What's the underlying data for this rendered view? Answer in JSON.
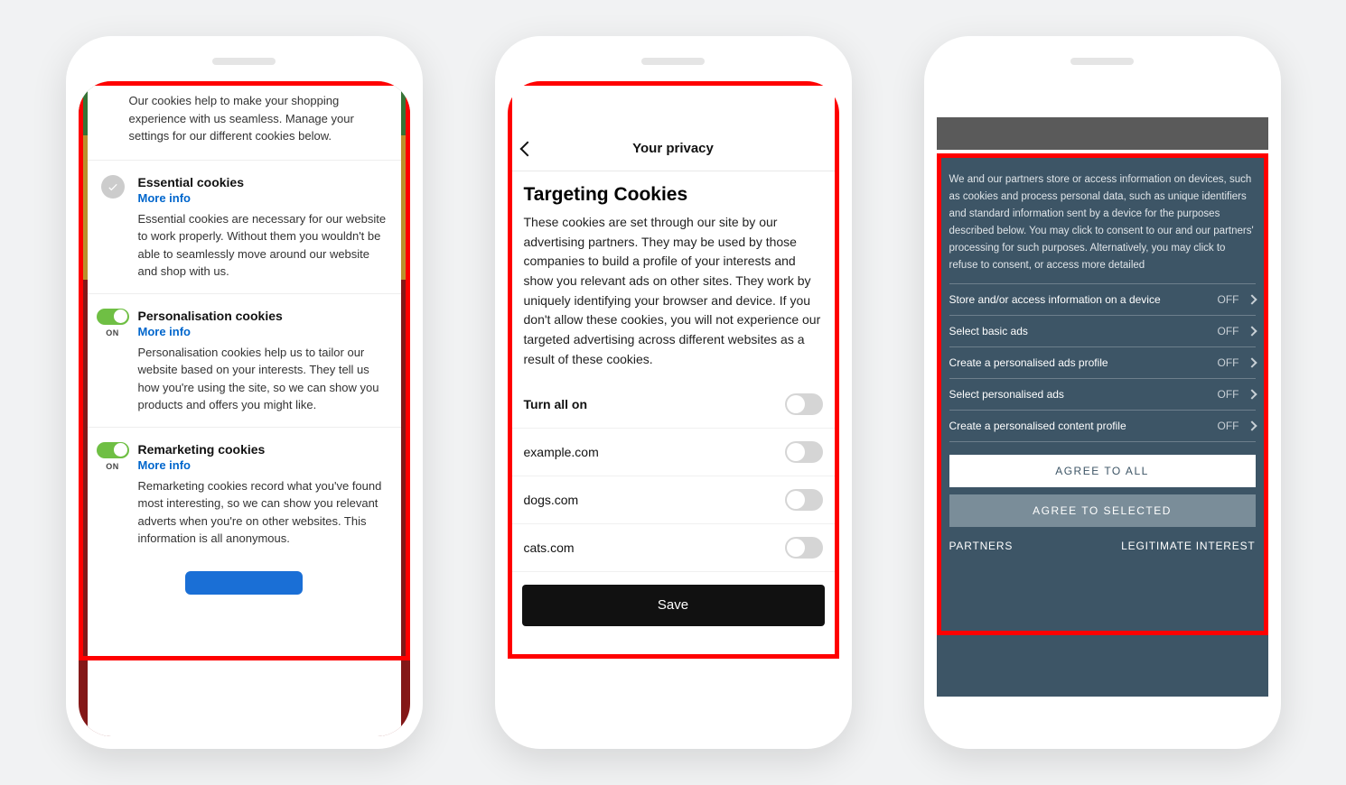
{
  "phone1": {
    "intro": "Our cookies help to make your shopping experience with us seamless. Manage your settings for our different cookies below.",
    "onLabel": "ON",
    "sections": [
      {
        "title": "Essential cookies",
        "more": "More info",
        "desc": "Essential cookies are necessary for our website to work properly. Without them you wouldn't be able to seamlessly move around our website and shop with us."
      },
      {
        "title": "Personalisation cookies",
        "more": "More info",
        "desc": "Personalisation cookies help us to tailor our website based on your interests. They tell us how you're using the site, so we can show you products and offers you might like."
      },
      {
        "title": "Remarketing cookies",
        "more": "More info",
        "desc": "Remarketing cookies record what you've found most interesting, so we can show you relevant adverts when you're on other websites. This information is all anonymous."
      }
    ]
  },
  "phone2": {
    "headerTitle": "Your privacy",
    "h1": "Targeting Cookies",
    "desc": "These cookies are set through our site by our advertising partners. They may be used by those companies to build a profile of your interests and show you relevant ads on other sites. They work by uniquely identifying your browser and device. If you don't allow these cookies, you will not experience our targeted advertising across different websites as a result of these cookies.",
    "rows": [
      {
        "label": "Turn all on"
      },
      {
        "label": "example.com"
      },
      {
        "label": "dogs.com"
      },
      {
        "label": "cats.com"
      }
    ],
    "save": "Save"
  },
  "phone3": {
    "intro": "We and our partners store or access information on devices, such as cookies and process personal data, such as unique identifiers and standard information sent by a device for the purposes described below. You may click to consent to our and our partners' processing for such purposes. Alternatively, you may click to refuse to consent, or access more detailed",
    "offLabel": "OFF",
    "rows": [
      {
        "label": "Store and/or access information on a device"
      },
      {
        "label": "Select basic ads"
      },
      {
        "label": "Create a personalised ads profile"
      },
      {
        "label": "Select personalised ads"
      },
      {
        "label": "Create a personalised content profile"
      }
    ],
    "agreeAll": "AGREE TO ALL",
    "agreeSelected": "AGREE TO SELECTED",
    "partners": "PARTNERS",
    "legit": "LEGITIMATE INTEREST"
  }
}
